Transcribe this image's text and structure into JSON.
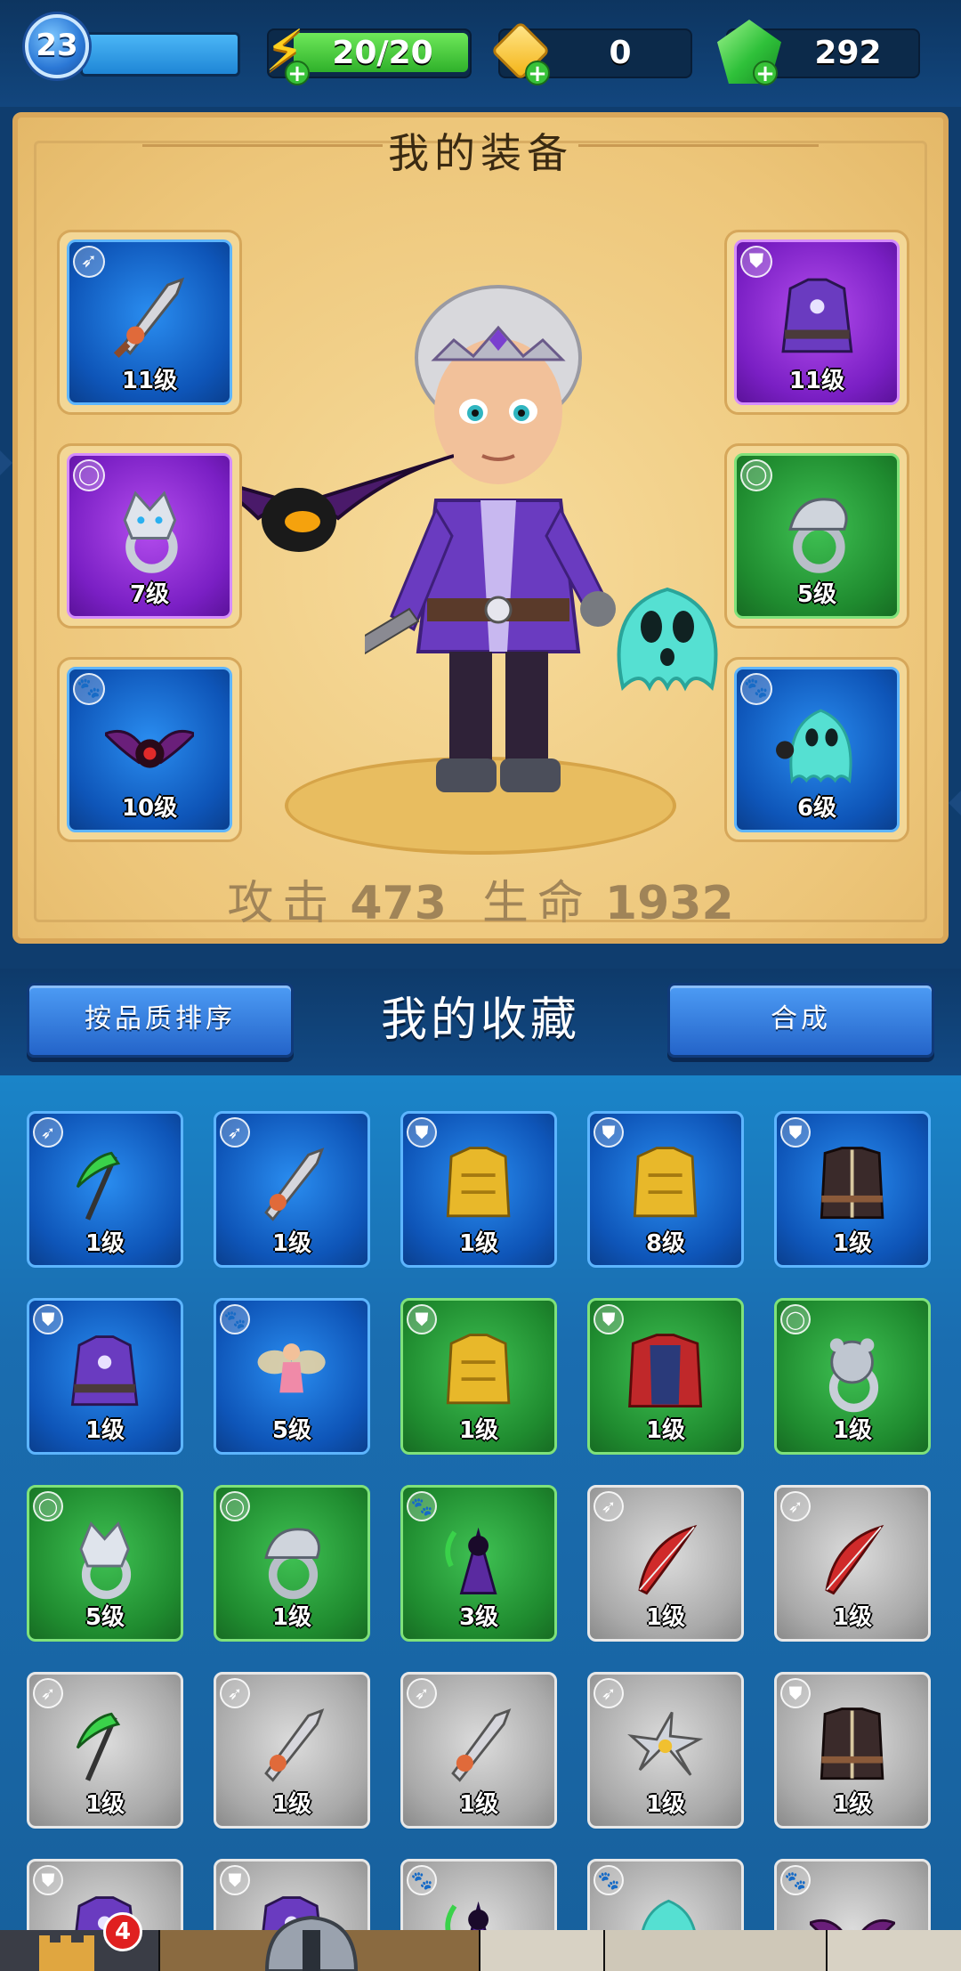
{
  "topbar": {
    "level": "23",
    "energy": "20/20",
    "tickets": "0",
    "gems": "292"
  },
  "equipment": {
    "title": "我的装备",
    "slots": [
      {
        "type": "weapon",
        "icon": "sword-icon",
        "quality": "blue",
        "level": "11级"
      },
      {
        "type": "armor",
        "icon": "purple-vest-icon",
        "quality": "purple",
        "level": "11级"
      },
      {
        "type": "ring",
        "icon": "wolf-ring-icon",
        "quality": "purple",
        "level": "7级"
      },
      {
        "type": "ring",
        "icon": "serpent-ring-icon",
        "quality": "green",
        "level": "5级"
      },
      {
        "type": "pet",
        "icon": "bat-pet-icon",
        "quality": "blue",
        "level": "10级"
      },
      {
        "type": "pet",
        "icon": "ghost-pet-icon",
        "quality": "blue",
        "level": "6级"
      }
    ],
    "attack_label": "攻击",
    "attack": "473",
    "hp_label": "生命",
    "hp": "1932"
  },
  "collection": {
    "sort_button": "按品质排序",
    "title": "我的收藏",
    "merge_button": "合成",
    "items": [
      {
        "icon": "scythe-icon",
        "type": "weapon",
        "quality": "blue",
        "level": "1级"
      },
      {
        "icon": "sword-icon",
        "type": "weapon",
        "quality": "blue",
        "level": "1级"
      },
      {
        "icon": "gold-armor-icon",
        "type": "armor",
        "quality": "blue",
        "level": "1级"
      },
      {
        "icon": "gold-armor-icon",
        "type": "armor",
        "quality": "blue",
        "level": "8级"
      },
      {
        "icon": "leather-vest-icon",
        "type": "armor",
        "quality": "blue",
        "level": "1级"
      },
      {
        "icon": "purple-vest-icon",
        "type": "armor",
        "quality": "blue",
        "level": "1级"
      },
      {
        "icon": "fairy-pet-icon",
        "type": "pet",
        "quality": "blue",
        "level": "5级"
      },
      {
        "icon": "gold-armor-icon",
        "type": "armor",
        "quality": "green",
        "level": "1级"
      },
      {
        "icon": "red-cloak-icon",
        "type": "armor",
        "quality": "green",
        "level": "1级"
      },
      {
        "icon": "bear-ring-icon",
        "type": "ring",
        "quality": "green",
        "level": "1级"
      },
      {
        "icon": "wolf-ring-icon",
        "type": "ring",
        "quality": "green",
        "level": "5级"
      },
      {
        "icon": "serpent-ring-icon",
        "type": "ring",
        "quality": "green",
        "level": "1级"
      },
      {
        "icon": "reaper-pet-icon",
        "type": "pet",
        "quality": "green",
        "level": "3级"
      },
      {
        "icon": "bow-icon",
        "type": "weapon",
        "quality": "gray",
        "level": "1级"
      },
      {
        "icon": "bow-icon",
        "type": "weapon",
        "quality": "gray",
        "level": "1级"
      },
      {
        "icon": "scythe-icon",
        "type": "weapon",
        "quality": "gray",
        "level": "1级"
      },
      {
        "icon": "sword-icon",
        "type": "weapon",
        "quality": "gray",
        "level": "1级"
      },
      {
        "icon": "sword-icon",
        "type": "weapon",
        "quality": "gray",
        "level": "1级"
      },
      {
        "icon": "shuriken-icon",
        "type": "weapon",
        "quality": "gray",
        "level": "1级"
      },
      {
        "icon": "leather-vest-icon",
        "type": "armor",
        "quality": "gray",
        "level": "1级"
      },
      {
        "icon": "purple-vest-icon",
        "type": "armor",
        "quality": "gray",
        "level": ""
      },
      {
        "icon": "purple-vest-icon",
        "type": "armor",
        "quality": "gray",
        "level": ""
      },
      {
        "icon": "reaper-pet-icon",
        "type": "pet",
        "quality": "gray",
        "level": ""
      },
      {
        "icon": "ghost-pet-icon",
        "type": "pet",
        "quality": "gray",
        "level": ""
      },
      {
        "icon": "bat-pet-icon",
        "type": "pet",
        "quality": "gray",
        "level": ""
      }
    ]
  },
  "bottom_nav": {
    "badge_count": "4",
    "tabs": [
      "castle-tab",
      "equipment-tab",
      "map-tab",
      "shop-tab",
      "hero-tab"
    ]
  },
  "colors": {
    "quality_blue": "#1a6fd6",
    "quality_purple": "#8a2fd0",
    "quality_green": "#2a9a3a",
    "quality_gray": "#a9a9a9",
    "panel_bg": "#f0cb80"
  }
}
